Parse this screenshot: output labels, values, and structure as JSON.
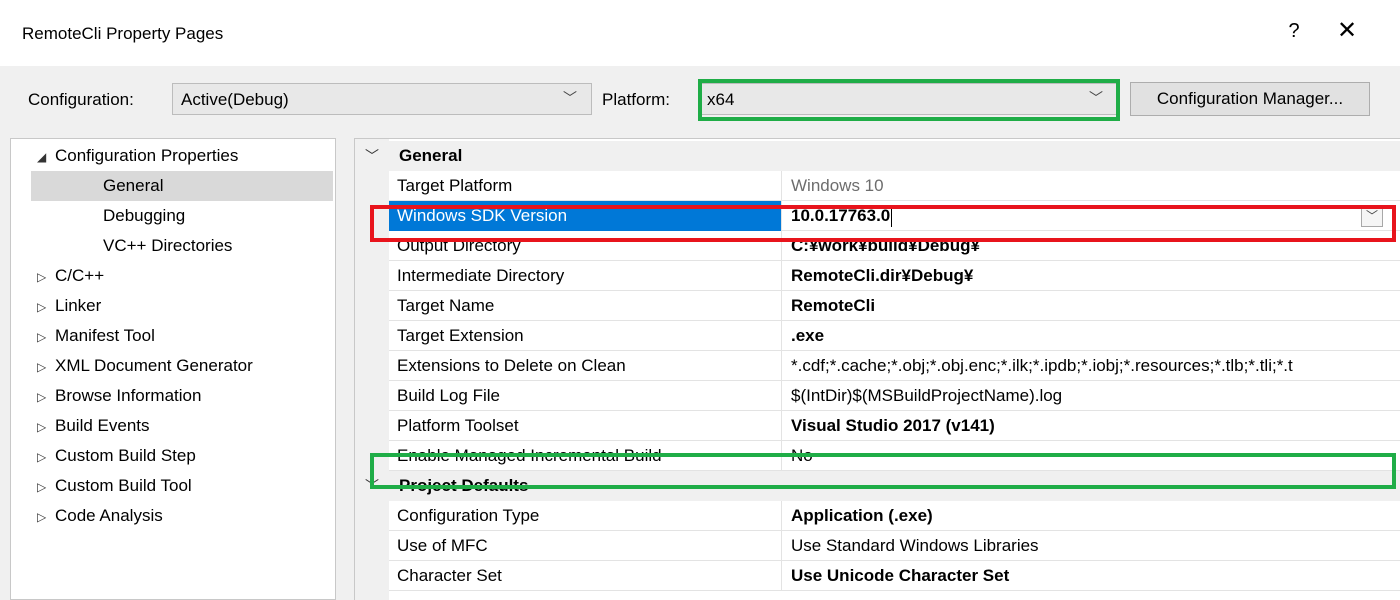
{
  "window": {
    "title": "RemoteCli Property Pages",
    "help_glyph": "?",
    "close_glyph": "✕"
  },
  "toolbar": {
    "configuration_label": "Configuration:",
    "configuration_value": "Active(Debug)",
    "platform_label": "Platform:",
    "platform_value": "x64",
    "config_manager_label": "Configuration Manager..."
  },
  "tree": {
    "root": "Configuration Properties",
    "items": [
      {
        "label": "General",
        "selected": true
      },
      {
        "label": "Debugging"
      },
      {
        "label": "VC++ Directories"
      },
      {
        "label": "C/C++",
        "expandable": true
      },
      {
        "label": "Linker",
        "expandable": true
      },
      {
        "label": "Manifest Tool",
        "expandable": true
      },
      {
        "label": "XML Document Generator",
        "expandable": true
      },
      {
        "label": "Browse Information",
        "expandable": true
      },
      {
        "label": "Build Events",
        "expandable": true
      },
      {
        "label": "Custom Build Step",
        "expandable": true
      },
      {
        "label": "Custom Build Tool",
        "expandable": true
      },
      {
        "label": "Code Analysis",
        "expandable": true
      }
    ]
  },
  "grid": {
    "sections": [
      {
        "title": "General",
        "rows": [
          {
            "name": "Target Platform",
            "value": "Windows 10",
            "style": "grey"
          },
          {
            "name": "Windows SDK Version",
            "value": "10.0.17763.0",
            "style": "bold",
            "selected": true
          },
          {
            "name": "Output Directory",
            "value": "C:¥work¥build¥Debug¥",
            "style": "bold"
          },
          {
            "name": "Intermediate Directory",
            "value": "RemoteCli.dir¥Debug¥",
            "style": "bold"
          },
          {
            "name": "Target Name",
            "value": "RemoteCli",
            "style": "bold"
          },
          {
            "name": "Target Extension",
            "value": ".exe",
            "style": "bold"
          },
          {
            "name": "Extensions to Delete on Clean",
            "value": "*.cdf;*.cache;*.obj;*.obj.enc;*.ilk;*.ipdb;*.iobj;*.resources;*.tlb;*.tli;*.t",
            "style": "normal"
          },
          {
            "name": "Build Log File",
            "value": "$(IntDir)$(MSBuildProjectName).log",
            "style": "normal"
          },
          {
            "name": "Platform Toolset",
            "value": "Visual Studio 2017 (v141)",
            "style": "bold"
          },
          {
            "name": "Enable Managed Incremental Build",
            "value": "No",
            "style": "normal"
          }
        ]
      },
      {
        "title": "Project Defaults",
        "rows": [
          {
            "name": "Configuration Type",
            "value": "Application (.exe)",
            "style": "bold"
          },
          {
            "name": "Use of MFC",
            "value": "Use Standard Windows Libraries",
            "style": "normal"
          },
          {
            "name": "Character Set",
            "value": "Use Unicode Character Set",
            "style": "bold"
          }
        ]
      }
    ]
  },
  "colors": {
    "highlight_green": "#1fad47",
    "highlight_red": "#e8141c",
    "selection_blue": "#0078d7"
  }
}
